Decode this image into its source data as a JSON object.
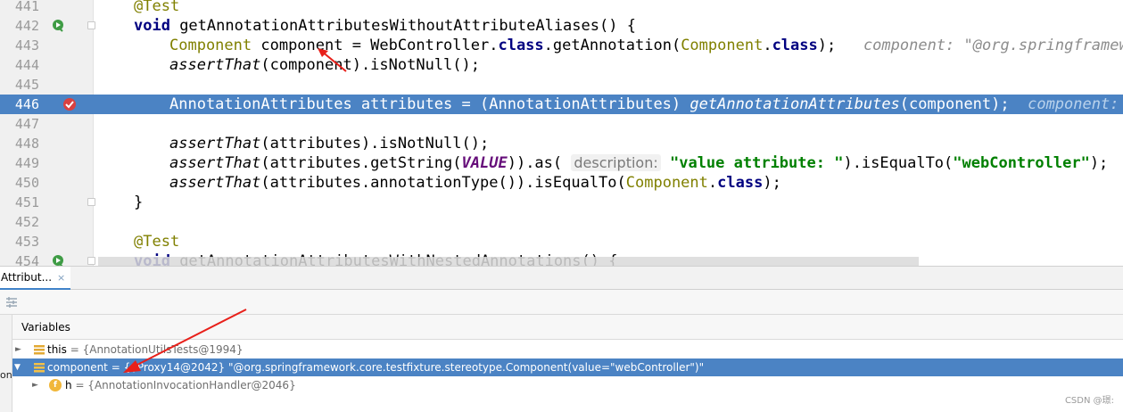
{
  "editor": {
    "lines": [
      {
        "num": "441",
        "code": "@Test"
      },
      {
        "num": "442",
        "code": "void getAnnotationAttributesWithoutAttributeAliases() {"
      },
      {
        "num": "443",
        "code": "Component component = WebController.class.getAnnotation(Component.class);",
        "inline": "component: \"@org.springframework"
      },
      {
        "num": "444",
        "code": "assertThat(component).isNotNull();"
      },
      {
        "num": "445",
        "code": ""
      },
      {
        "num": "446",
        "code": "AnnotationAttributes attributes = (AnnotationAttributes) getAnnotationAttributes(component);",
        "inline": "component: \"@"
      },
      {
        "num": "447",
        "code": ""
      },
      {
        "num": "448",
        "code": "assertThat(attributes).isNotNull();"
      },
      {
        "num": "449",
        "code": "assertThat(attributes.getString(VALUE)).as( description: \"value attribute: \").isEqualTo(\"webController\");",
        "hint": "description:"
      },
      {
        "num": "450",
        "code": "assertThat(attributes.annotationType()).isEqualTo(Component.class);"
      },
      {
        "num": "451",
        "code": "}"
      },
      {
        "num": "452",
        "code": ""
      },
      {
        "num": "453",
        "code": "@Test"
      },
      {
        "num": "454",
        "code": "void getAnnotationAttributesWithNestedAnnotations() {"
      }
    ]
  },
  "debug": {
    "tab_label": "Attribut...",
    "tab_close": "×",
    "variables_title": "Variables",
    "left_strip_label": "on",
    "vars": [
      {
        "name": "this",
        "value": "= {AnnotationUtilsTests@1994}",
        "expanded": false
      },
      {
        "name": "component",
        "value": "= {$Proxy14@2042} \"@org.springframework.core.testfixture.stereotype.Component(value=\"webController\")\"",
        "expanded": true,
        "selected": true
      },
      {
        "name": "h",
        "value": "= {AnnotationInvocationHandler@2046}",
        "expanded": false,
        "field": "f"
      }
    ]
  },
  "watermark": "CSDN @璟:",
  "colors": {
    "selection": "#4b83c4",
    "keyword": "#000080",
    "annotation": "#808000",
    "string": "#008000",
    "arrow": "#e8201a"
  }
}
